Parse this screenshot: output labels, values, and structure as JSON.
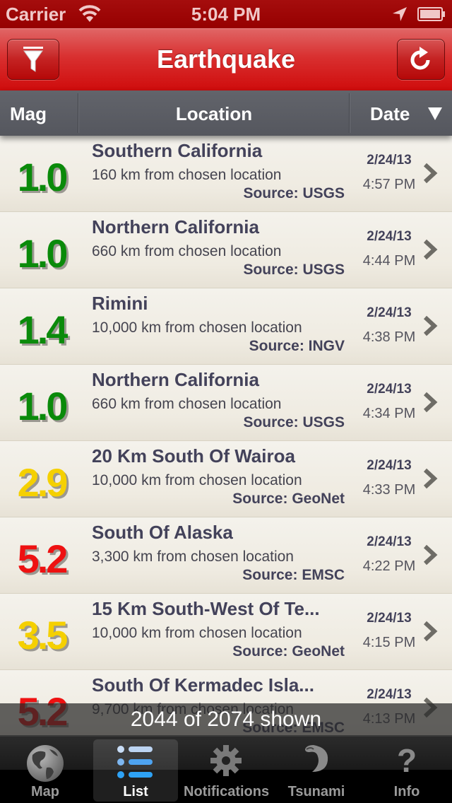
{
  "status_bar": {
    "carrier": "Carrier",
    "time": "5:04 PM"
  },
  "nav": {
    "title": "Earthquake",
    "left_button": "filter-icon",
    "right_button": "refresh-icon"
  },
  "columns": {
    "mag": "Mag",
    "location": "Location",
    "date": "Date",
    "sort_direction": "descending"
  },
  "colors": {
    "low": "#0a8a0a",
    "medium": "#f5d000",
    "high": "#ee1111",
    "accent": "#cf0c0c"
  },
  "quakes": [
    {
      "mag": "1.0",
      "level": "low",
      "location": "Southern California",
      "distance": "160 km from chosen location",
      "source": "Source: USGS",
      "date": "2/24/13",
      "time": "4:57 PM"
    },
    {
      "mag": "1.0",
      "level": "low",
      "location": "Northern California",
      "distance": "660 km from chosen location",
      "source": "Source: USGS",
      "date": "2/24/13",
      "time": "4:44 PM"
    },
    {
      "mag": "1.4",
      "level": "low",
      "location": "Rimini",
      "distance": "10,000 km from chosen location",
      "source": "Source: INGV",
      "date": "2/24/13",
      "time": "4:38 PM"
    },
    {
      "mag": "1.0",
      "level": "low",
      "location": "Northern California",
      "distance": "660 km from chosen location",
      "source": "Source: USGS",
      "date": "2/24/13",
      "time": "4:34 PM"
    },
    {
      "mag": "2.9",
      "level": "medium",
      "location": "20 Km South Of Wairoa",
      "distance": "10,000 km from chosen location",
      "source": "Source: GeoNet",
      "date": "2/24/13",
      "time": "4:33 PM"
    },
    {
      "mag": "5.2",
      "level": "high",
      "location": "South Of Alaska",
      "distance": "3,300 km from chosen location",
      "source": "Source: EMSC",
      "date": "2/24/13",
      "time": "4:22 PM"
    },
    {
      "mag": "3.5",
      "level": "medium",
      "location": "15 Km South-West Of Te...",
      "distance": "10,000 km from chosen location",
      "source": "Source: GeoNet",
      "date": "2/24/13",
      "time": "4:15 PM"
    },
    {
      "mag": "5.2",
      "level": "high",
      "location": "South Of Kermadec Isla...",
      "distance": "9,700 km from chosen location",
      "source": "Source: EMSC",
      "date": "2/24/13",
      "time": "4:13 PM"
    }
  ],
  "toast": "2044 of 2074 shown",
  "tabs": [
    {
      "label": "Map",
      "icon": "globe-icon",
      "active": false
    },
    {
      "label": "List",
      "icon": "list-icon",
      "active": true
    },
    {
      "label": "Notifications",
      "icon": "gear-icon",
      "active": false
    },
    {
      "label": "Tsunami",
      "icon": "wave-icon",
      "active": false
    },
    {
      "label": "Info",
      "icon": "question-icon",
      "active": false
    }
  ]
}
